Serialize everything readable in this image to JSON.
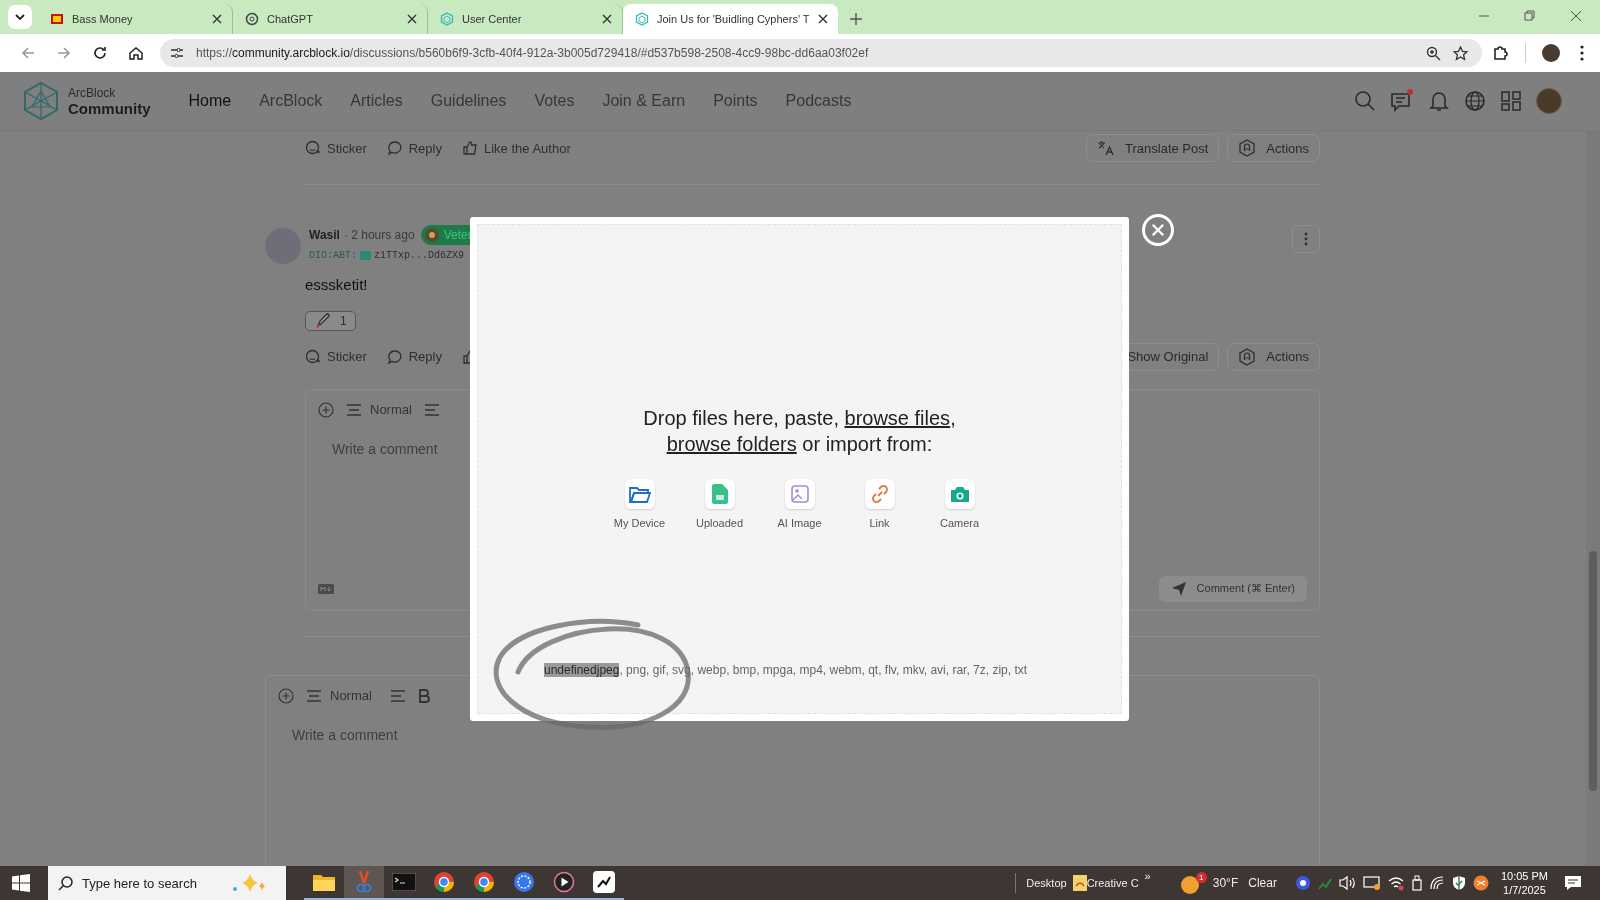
{
  "browser": {
    "tabs": [
      {
        "title": "Bass Money",
        "selected": false
      },
      {
        "title": "ChatGPT",
        "selected": false
      },
      {
        "title": "User Center",
        "selected": false
      },
      {
        "title": "Join Us for 'Buidling Cyphers' T",
        "selected": true
      }
    ],
    "url": {
      "scheme": "https://",
      "host": "community.arcblock.io",
      "path": "/discussions/b560b6f9-3cfb-40f4-912a-3b005d729418/#d537b598-2508-4cc9-98bc-dd6aa03f02ef"
    }
  },
  "site": {
    "logo_top": "ArcBlock",
    "logo_bottom": "Community",
    "nav": [
      {
        "label": "Home",
        "selected": true
      },
      {
        "label": "ArcBlock",
        "selected": false
      },
      {
        "label": "Articles",
        "selected": false
      },
      {
        "label": "Guidelines",
        "selected": false
      },
      {
        "label": "Votes",
        "selected": false
      },
      {
        "label": "Join & Earn",
        "selected": false
      },
      {
        "label": "Points",
        "selected": false
      },
      {
        "label": "Podcasts",
        "selected": false
      }
    ],
    "messages_unread": true
  },
  "post_actions": {
    "items": [
      {
        "kind": "sticker",
        "label": "Sticker"
      },
      {
        "kind": "reply",
        "label": "Reply"
      },
      {
        "kind": "like",
        "label": "Like the Author"
      }
    ],
    "buttons": [
      {
        "kind": "translate",
        "label": "Translate Post"
      },
      {
        "kind": "actions",
        "label": "Actions"
      }
    ]
  },
  "comment": {
    "author": "Wasil",
    "time": "· 2 hours ago",
    "badge": "Veter",
    "did_prefix": "DID:ABT:",
    "did": "z1TTxp...Dd6ZX9",
    "body": "esssketit!",
    "reaction_count": "1",
    "actions": [
      {
        "kind": "sticker",
        "label": "Sticker"
      },
      {
        "kind": "reply",
        "label": "Reply"
      },
      {
        "kind": "like"
      }
    ],
    "buttons": [
      {
        "kind": "plain",
        "label": "Show Original"
      },
      {
        "kind": "actions",
        "label": "Actions"
      }
    ]
  },
  "reply_editor": {
    "style": "Normal",
    "placeholder": "Write a comment",
    "submit": "Comment (⌘ Enter)",
    "submit_disabled": true
  },
  "main_editor": {
    "style": "Normal",
    "placeholder": "Write a comment"
  },
  "upload_dialog": {
    "prompt": [
      {
        "kind": "text",
        "text": "Drop files here, paste, "
      },
      {
        "kind": "link",
        "text": "browse files"
      },
      {
        "kind": "text",
        "text": ","
      },
      {
        "kind": "break"
      },
      {
        "kind": "link",
        "text": "browse folders"
      },
      {
        "kind": "text",
        "text": " or import from:"
      }
    ],
    "sources": [
      {
        "kind": "device",
        "label": "My Device"
      },
      {
        "kind": "uploaded",
        "label": "Uploaded"
      },
      {
        "kind": "ai",
        "label": "AI Image"
      },
      {
        "kind": "link",
        "label": "Link"
      },
      {
        "kind": "camera",
        "label": "Camera"
      }
    ],
    "file_types_selected": "undefinedjpeg",
    "file_types_rest": ", png, gif, svg, webp, bmp, mpga, mp4, webm, qt, flv, mkv, avi, rar, 7z, zip, txt"
  },
  "taskbar": {
    "search_placeholder": "Type here to search",
    "apps": [
      {
        "kind": "explorer",
        "selected": false
      },
      {
        "kind": "snip",
        "selected": true
      },
      {
        "kind": "terminal",
        "selected": false
      },
      {
        "kind": "chrome",
        "selected": false
      },
      {
        "kind": "chrome",
        "selected": false
      },
      {
        "kind": "signal",
        "selected": false
      },
      {
        "kind": "player",
        "selected": false
      },
      {
        "kind": "app",
        "selected": false
      }
    ],
    "desktop": "Desktop",
    "pinned": "Creative C",
    "overflow": "»",
    "weather_alert": "1",
    "temperature": "30°F",
    "condition": "Clear",
    "time": "10:05 PM",
    "date": "1/7/2025"
  }
}
